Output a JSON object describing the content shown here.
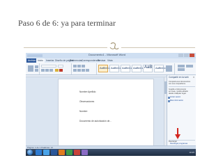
{
  "slide": {
    "title": "Paso 6 de 6: ya para terminar",
    "ornament_icon": "decorative-flourish-icon"
  },
  "screenshot": {
    "window_title": "Documento1 - Microsoft Word",
    "ribbon_tabs": [
      "Archivo",
      "Inicio",
      "Insertar",
      "Diseño de página",
      "Referencias",
      "Correspondencia",
      "Revisar",
      "Vista"
    ],
    "active_tab": "Inicio",
    "styles_gallery": [
      "AaBbCcDc",
      "AaBbCcDc",
      "AaBbCc",
      "AaBbCc",
      "AaB",
      "AaBbCc"
    ],
    "document_lines": [
      "Nombre Apellido",
      "Observaciones",
      "Nombre",
      "Documento de autorización de..."
    ],
    "pane": {
      "title": "Compartir en la web",
      "paragraphs": [
        "Comparta sus documentos",
        "con sus compañeros.",
        "Guarde el documento",
        "en línea y podrá editarlo",
        "desde cualquier lugar."
      ],
      "links": [
        "Iniciar sesión",
        "Más información"
      ],
      "bottom_label": "Descargar",
      "bottom_link": "Descargar programas"
    },
    "status_text": "Página: 1 de 1   Palabras: 12",
    "clock": "10:25",
    "accent_color": "#2b579a",
    "arrow_color": "#d2261f"
  }
}
